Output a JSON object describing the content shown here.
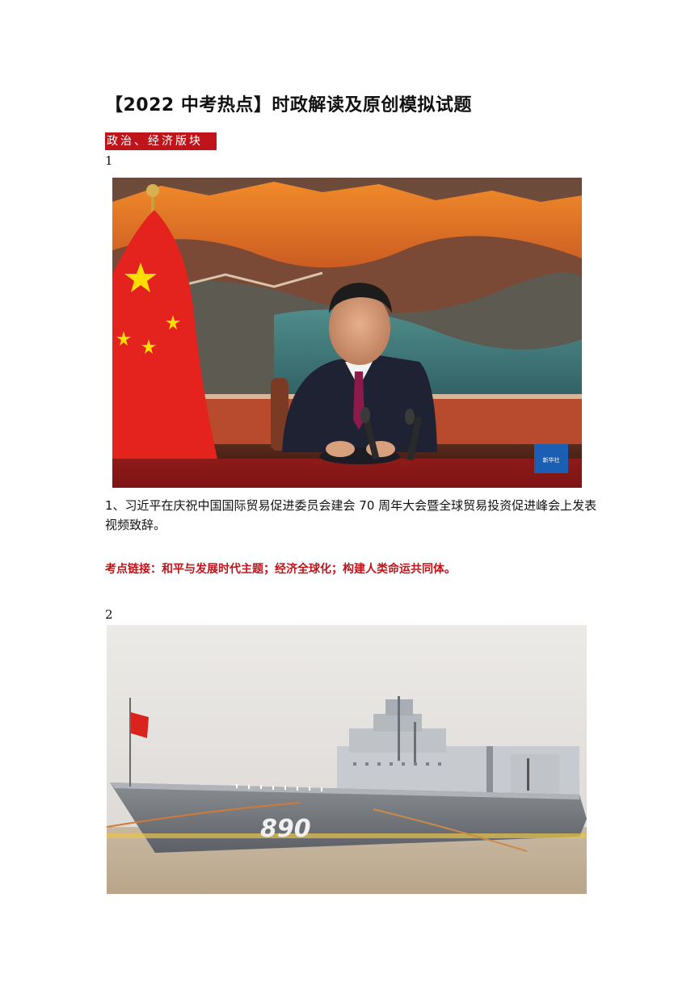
{
  "doc": {
    "title": "【2022 中考热点】时政解读及原创模拟试题",
    "section_tag": "政治、经济版块"
  },
  "items": [
    {
      "number": "1",
      "caption": "1、习近平在庆祝中国国际贸易促进委员会建会 70 周年大会暨全球贸易投资促进峰会上发表视频致辞。",
      "exam_link": "考点链接：和平与发展时代主题；经济全球化；构建人类命运共同体。",
      "photo_badge": "新华社"
    },
    {
      "number": "2",
      "hull_number": "890"
    }
  ],
  "colors": {
    "accent_red": "#c0141b"
  }
}
